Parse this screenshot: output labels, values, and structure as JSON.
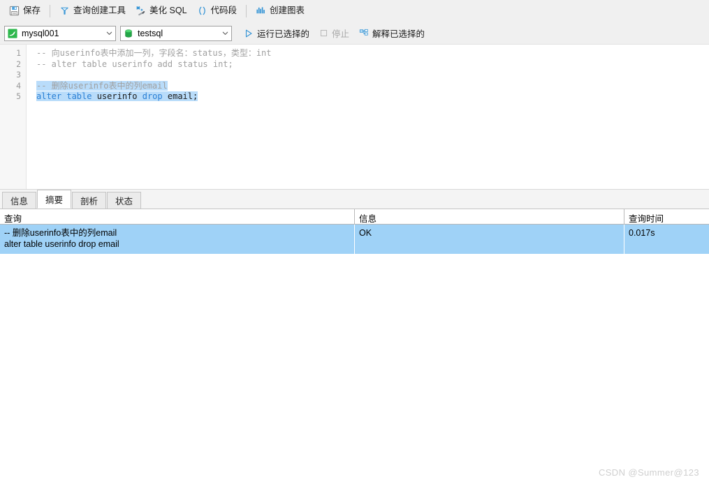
{
  "toolbar": {
    "items": [
      {
        "label": "保存",
        "icon": "save-icon"
      },
      {
        "label": "查询创建工具",
        "icon": "query-builder-icon"
      },
      {
        "label": "美化 SQL",
        "icon": "beautify-sql-icon"
      },
      {
        "label": "代码段",
        "icon": "code-snippet-icon"
      },
      {
        "label": "创建图表",
        "icon": "create-chart-icon"
      }
    ]
  },
  "connection_bar": {
    "connection": {
      "value": "mysql001",
      "icon": "mysql-dolphin-icon"
    },
    "database": {
      "value": "testsql",
      "icon": "database-cylinder-icon"
    },
    "run_selected": "运行已选择的",
    "stop": "停止",
    "explain_selected": "解释已选择的"
  },
  "editor": {
    "line_numbers": [
      "1",
      "2",
      "3",
      "4",
      "5"
    ],
    "lines": [
      {
        "num": "1",
        "selected": false,
        "segments": [
          {
            "text": "-- 向userinfo表中添加一列，字段名：status，类型：int",
            "type": "comment"
          }
        ]
      },
      {
        "num": "2",
        "selected": false,
        "segments": [
          {
            "text": "-- alter table userinfo add status int;",
            "type": "comment"
          }
        ]
      },
      {
        "num": "3",
        "selected": false,
        "segments": [
          {
            "text": "",
            "type": "plain"
          }
        ]
      },
      {
        "num": "4",
        "selected": true,
        "segments": [
          {
            "text": "-- 删除userinfo表中的列email",
            "type": "comment"
          }
        ]
      },
      {
        "num": "5",
        "selected": true,
        "segments": [
          {
            "text": "alter",
            "type": "kw"
          },
          {
            "text": " ",
            "type": "plain"
          },
          {
            "text": "table",
            "type": "kw"
          },
          {
            "text": " userinfo ",
            "type": "plain"
          },
          {
            "text": "drop",
            "type": "kw"
          },
          {
            "text": " email;",
            "type": "plain"
          }
        ]
      }
    ]
  },
  "tabs": [
    {
      "label": "信息",
      "active": false
    },
    {
      "label": "摘要",
      "active": true
    },
    {
      "label": "剖析",
      "active": false
    },
    {
      "label": "状态",
      "active": false
    }
  ],
  "result_grid": {
    "columns": [
      "查询",
      "信息",
      "查询时间"
    ],
    "rows": [
      {
        "query": "-- 删除userinfo表中的列email\nalter table userinfo drop email",
        "message": "OK",
        "time": "0.017s"
      }
    ]
  },
  "watermark": "CSDN @Summer@123",
  "colors": {
    "accent": "#2a7fd4",
    "selection": "#b9dcfa",
    "row_selected": "#9fd2f7",
    "toolbar_bg": "#f0f0f0",
    "mysql_green": "#2eb84d"
  }
}
